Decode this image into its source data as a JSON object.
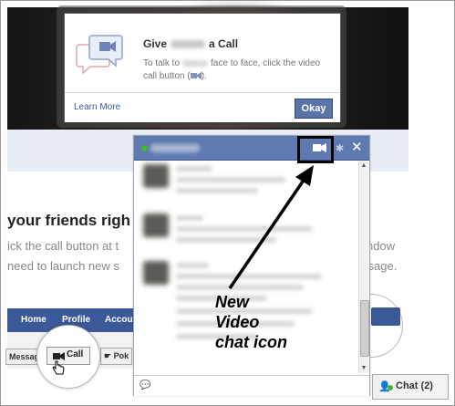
{
  "tooltip": {
    "title_prefix": "Give",
    "title_suffix": "a Call",
    "desc_prefix": "To talk to",
    "desc_suffix": "face to face, click the video call button (",
    "desc_end": ").",
    "learn_more": "Learn More",
    "okay": "Okay"
  },
  "background": {
    "heading": "your friends righ",
    "line1_left": "ick the call button at t",
    "line2_left": "need to launch new s",
    "line1_right": "ndow",
    "line2_right": "ssage.",
    "nav": {
      "home": "Home",
      "profile": "Profile",
      "account": "Accou"
    },
    "message_btn": "Message",
    "call_btn": "Call",
    "poke_btn": "Pok"
  },
  "annotation": {
    "line1": "New",
    "line2": "Video",
    "line3": "chat icon"
  },
  "chat_tab": {
    "label": "Chat (2)"
  },
  "colors": {
    "fb_blue": "#3b5998",
    "chat_header": "#5f7ab0",
    "online_green": "#42b72a",
    "button_blue": "#5b74a8"
  }
}
